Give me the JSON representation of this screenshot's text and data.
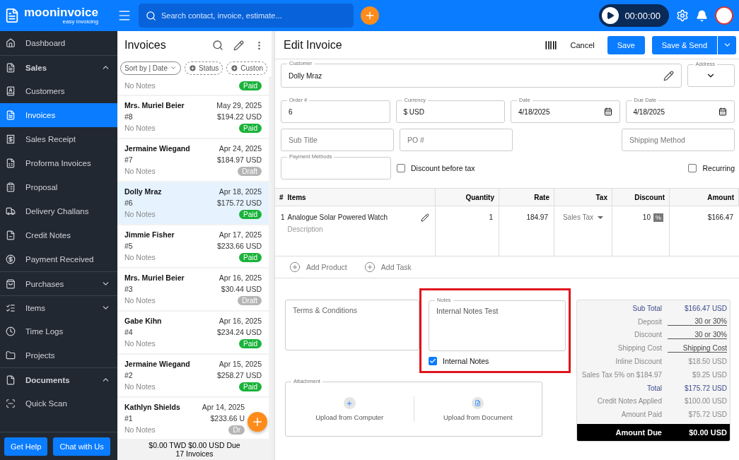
{
  "topbar": {
    "brand": "mooninvoice",
    "tagline": "easy invoicing",
    "search_placeholder": "Search contact, invoice, estimate...",
    "timer": "00:00:00"
  },
  "sidebar": {
    "items": [
      {
        "label": "Dashboard",
        "kind": "item",
        "selected": false
      },
      {
        "label": "Sales",
        "kind": "group",
        "expanded": true
      },
      {
        "label": "Customers",
        "kind": "item",
        "selected": false
      },
      {
        "label": "Invoices",
        "kind": "item",
        "selected": true
      },
      {
        "label": "Sales Receipt",
        "kind": "item",
        "selected": false
      },
      {
        "label": "Proforma Invoices",
        "kind": "item",
        "selected": false
      },
      {
        "label": "Proposal",
        "kind": "item",
        "selected": false
      },
      {
        "label": "Delivery Challans",
        "kind": "item",
        "selected": false
      },
      {
        "label": "Credit Notes",
        "kind": "item",
        "selected": false
      },
      {
        "label": "Payment Received",
        "kind": "item",
        "selected": false
      },
      {
        "label": "Purchases",
        "kind": "group",
        "expanded": false
      },
      {
        "label": "Items",
        "kind": "group",
        "expanded": false
      },
      {
        "label": "Time Logs",
        "kind": "item",
        "selected": false
      },
      {
        "label": "Projects",
        "kind": "item",
        "selected": false
      },
      {
        "label": "Documents",
        "kind": "group",
        "expanded": true
      },
      {
        "label": "Quick Scan",
        "kind": "item",
        "selected": false
      }
    ],
    "buttons": [
      "Get Help",
      "Chat with Us"
    ]
  },
  "invoice_list": {
    "title": "Invoices",
    "filters": [
      {
        "label": "Sort by | Date",
        "kind": "sort"
      },
      {
        "label": "Status",
        "kind": "add"
      },
      {
        "label": "Custon",
        "kind": "add"
      }
    ],
    "rows": [
      {
        "notes": "No Notes",
        "status": "Paid",
        "color": "#19b339",
        "selected": false
      },
      {
        "customer": "Mrs. Muriel Beier",
        "number": "#8",
        "date": "May 29, 2025",
        "amount": "$194.22 USD",
        "notes": "No Notes",
        "status": "Paid",
        "color": "#19b339",
        "selected": false
      },
      {
        "customer": "Jermaine Wiegand",
        "number": "#7",
        "date": "Apr 24, 2025",
        "amount": "$184.97 USD",
        "notes": "No Notes",
        "status": "Draft",
        "color": "#b5b5b5",
        "selected": false
      },
      {
        "customer": "Dolly Mraz",
        "number": "#6",
        "date": "Apr 18, 2025",
        "amount": "$175.72 USD",
        "notes": "No Notes",
        "status": "Paid",
        "color": "#19b339",
        "selected": true
      },
      {
        "customer": "Jimmie Fisher",
        "number": "#5",
        "date": "Apr 17, 2025",
        "amount": "$233.66 USD",
        "notes": "No Notes",
        "status": "Paid",
        "color": "#19b339",
        "selected": false
      },
      {
        "customer": "Mrs. Muriel Beier",
        "number": "#3",
        "date": "Apr 16, 2025",
        "amount": "$30.44 USD",
        "notes": "No Notes",
        "status": "Draft",
        "color": "#b5b5b5",
        "selected": false
      },
      {
        "customer": "Gabe Kihn",
        "number": "#4",
        "date": "Apr 16, 2025",
        "amount": "$234.24 USD",
        "notes": "No Notes",
        "status": "Paid",
        "color": "#19b339",
        "selected": false
      },
      {
        "customer": "Jermaine Wiegand",
        "number": "#2",
        "date": "Apr 15, 2025",
        "amount": "$258.27 USD",
        "notes": "No Notes",
        "status": "Paid",
        "color": "#19b339",
        "selected": false
      },
      {
        "customer": "Kathlyn Shields",
        "number": "#1",
        "date": "Apr 14, 2025",
        "amount": "$233.66 U",
        "notes": "No Notes",
        "status": "Dr",
        "color": "#b5b5b5",
        "selected": false
      }
    ],
    "summary": "$0.00 TWD  $0.00 USD  Due",
    "count": "17 Invoices"
  },
  "editor": {
    "title": "Edit Invoice",
    "cancel": "Cancel",
    "save": "Save",
    "save_send": "Save & Send",
    "customer": {
      "label": "Customer",
      "value": "Dolly Mraz"
    },
    "address": {
      "label": "Address"
    },
    "fields": [
      {
        "label": "Order #",
        "value": "6",
        "kind": "text"
      },
      {
        "label": "Currency",
        "value": "$ USD",
        "kind": "text"
      },
      {
        "label": "Date",
        "value": "4/18/2025",
        "kind": "date"
      },
      {
        "label": "Due Date",
        "value": "4/18/2025",
        "kind": "date"
      }
    ],
    "sub_title": {
      "placeholder": "Sub Title"
    },
    "po": {
      "placeholder": "PO #"
    },
    "shipping_method": {
      "placeholder": "Shipping Method"
    },
    "payment_methods": {
      "label": "Payment Methods"
    },
    "discount_before_tax": {
      "label": "Discount before tax",
      "checked": false
    },
    "recurring": {
      "label": "Recurring",
      "checked": false
    },
    "table": {
      "columns": [
        "#",
        "Items",
        "Quantity",
        "Rate",
        "Tax",
        "Discount",
        "Amount"
      ],
      "rows": [
        {
          "index": "1",
          "item": "Analogue Solar Powered Watch",
          "description": "Description",
          "quantity": "1",
          "rate": "184.97",
          "tax": "Sales Tax",
          "discount": "10",
          "discount_unit": "%",
          "amount": "$166.47"
        }
      ]
    },
    "add_product": "Add Product",
    "add_task": "Add Task",
    "terms": {
      "placeholder": "Terms & Conditions"
    },
    "notes": {
      "label": "Notes",
      "value": "Internal Notes Test",
      "highlighted": true
    },
    "internal_notes": {
      "label": "Internal Notes",
      "checked": true
    },
    "attachment": {
      "label": "Attachment",
      "options": [
        "Upload from Computer",
        "Upload from Document"
      ]
    },
    "totals": [
      {
        "label": "Sub Total",
        "value": "$166.47 USD",
        "kind": "emphasis"
      },
      {
        "label": "Deposit",
        "value": "30 or 30%",
        "kind": "input"
      },
      {
        "label": "Discount",
        "value": "30 or 30%",
        "kind": "input"
      },
      {
        "label": "Shipping Cost",
        "value": "Shipping Cost",
        "kind": "input"
      },
      {
        "label": "Inline Discount",
        "value": "$18.50 USD",
        "kind": "plain"
      },
      {
        "label": "Sales Tax 5% on $184.97",
        "value": "$9.25 USD",
        "kind": "plain"
      },
      {
        "label": "Total",
        "value": "$175.72 USD",
        "kind": "emphasis"
      },
      {
        "label": "Credit Notes Applied",
        "value": "$100.00 USD",
        "kind": "plain"
      },
      {
        "label": "Amount Paid",
        "value": "$75.72 USD",
        "kind": "plain"
      },
      {
        "label": "Amount Due",
        "value": "$0.00 USD",
        "kind": "due"
      }
    ]
  }
}
